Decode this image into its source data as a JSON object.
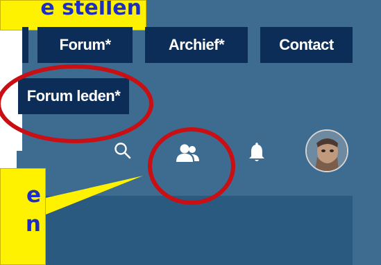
{
  "callouts": {
    "top_text": "e stellen",
    "bottom_lines": [
      "e",
      "n"
    ]
  },
  "nav": {
    "forum": "Forum*",
    "archief": "Archief*",
    "contact": "Contact",
    "forum_leden": "Forum leden*"
  },
  "icons": {
    "search": "search-icon",
    "members": "users-icon",
    "notifications": "bell-icon",
    "avatar": "user-avatar"
  },
  "colors": {
    "background": "#3e6b90",
    "nav_button": "#0b2d57",
    "callout": "#fff200",
    "callout_text": "#1c2fc1",
    "annotation_ring": "#c80f14"
  }
}
